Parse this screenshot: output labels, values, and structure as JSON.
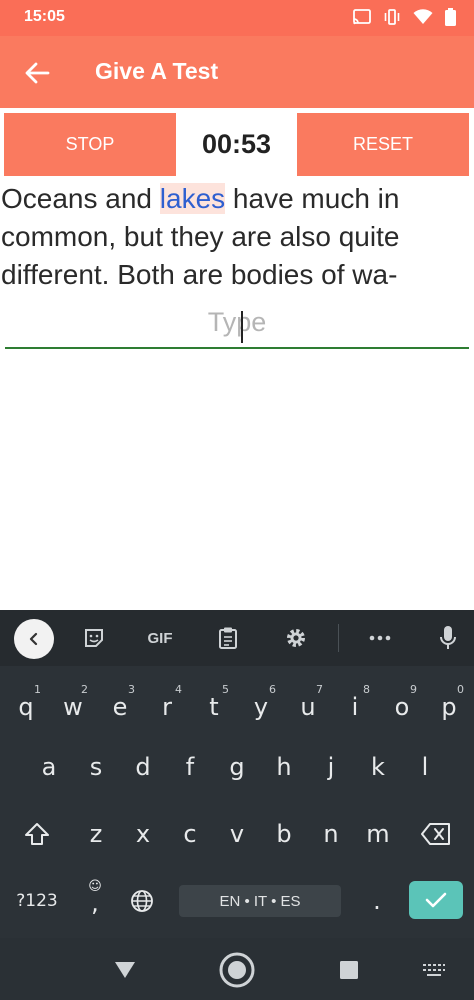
{
  "status_bar": {
    "time": "15:05",
    "icons": [
      "cast-icon",
      "vibrate-icon",
      "wifi-icon",
      "battery-icon"
    ]
  },
  "app_bar": {
    "title": "Give A Test",
    "back_icon": "back-arrow-icon"
  },
  "controls": {
    "stop_label": "STOP",
    "timer": "00:53",
    "reset_label": "RESET"
  },
  "passage": {
    "line1_before": "Oceans and ",
    "highlight_word": "lakes",
    "line1_after": " have much in",
    "line2": "common, but they are also quite",
    "line3": "different. Both are bodies of wa-"
  },
  "input": {
    "placeholder": "Type"
  },
  "keyboard": {
    "toolbar": {
      "gif_label": "GIF",
      "icons": [
        "chevron-left-icon",
        "sticker-icon",
        "clipboard-icon",
        "settings-icon",
        "more-icon",
        "mic-icon"
      ]
    },
    "row1": [
      {
        "key": "q",
        "hint": "1"
      },
      {
        "key": "w",
        "hint": "2"
      },
      {
        "key": "e",
        "hint": "3"
      },
      {
        "key": "r",
        "hint": "4"
      },
      {
        "key": "t",
        "hint": "5"
      },
      {
        "key": "y",
        "hint": "6"
      },
      {
        "key": "u",
        "hint": "7"
      },
      {
        "key": "i",
        "hint": "8"
      },
      {
        "key": "o",
        "hint": "9"
      },
      {
        "key": "p",
        "hint": "0"
      }
    ],
    "row2": [
      "a",
      "s",
      "d",
      "f",
      "g",
      "h",
      "j",
      "k",
      "l"
    ],
    "row3": [
      "z",
      "x",
      "c",
      "v",
      "b",
      "n",
      "m"
    ],
    "symbols_label": "?123",
    "comma_label": ",",
    "period_label": ".",
    "space_label": "EN • IT • ES"
  },
  "colors": {
    "accent": "#fa7a5f",
    "status_bar": "#fa6e57",
    "highlight_bg": "#fde3dc",
    "highlight_text": "#2f5fd0",
    "underline": "#2e7d32",
    "keyboard_bg": "#2c3237",
    "enter_key": "#5bc4b8"
  }
}
